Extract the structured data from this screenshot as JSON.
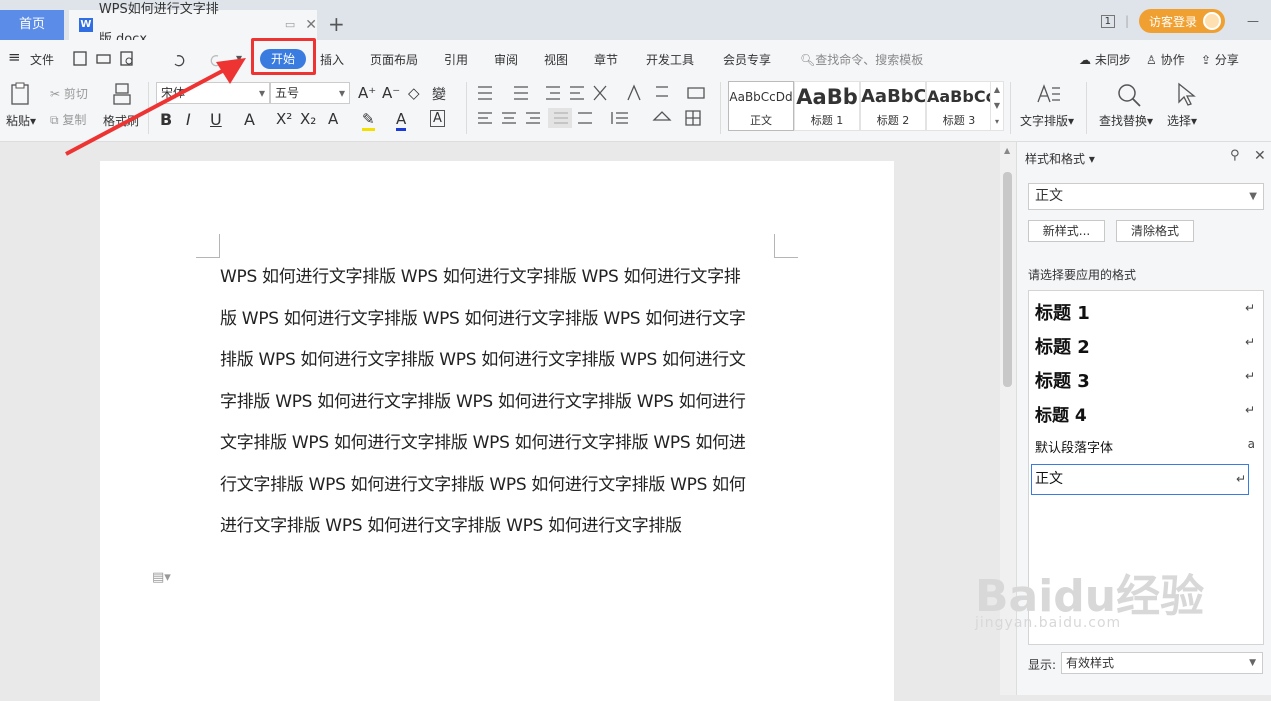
{
  "tabs": {
    "home": "首页",
    "doc": "WPS如何进行文字排版.docx",
    "new": "+"
  },
  "topright": {
    "window_num": "1",
    "login": "访客登录"
  },
  "menu": {
    "hamburger": "≡",
    "file": "文件",
    "items": [
      "开始",
      "插入",
      "页面布局",
      "引用",
      "审阅",
      "视图",
      "章节",
      "开发工具",
      "会员专享"
    ],
    "search": "查找命令、搜索模板",
    "sync": "未同步",
    "collab": "协作",
    "share": "分享"
  },
  "ribbon": {
    "paste": "粘贴",
    "cut": "剪切",
    "copy": "复制",
    "format_painter": "格式刷",
    "font": "宋体",
    "size": "五号",
    "styles": [
      {
        "preview": "AaBbCcDd",
        "label": "正文"
      },
      {
        "preview": "AaBb",
        "label": "标题 1"
      },
      {
        "preview": "AaBbC",
        "label": "标题 2"
      },
      {
        "preview": "AaBbCc",
        "label": "标题 3"
      }
    ],
    "text_layout": "文字排版",
    "find_replace": "查找替换",
    "select": "选择"
  },
  "document": {
    "lines": [
      "WPS 如何进行文字排版 WPS 如何进行文字排版 WPS 如何进行文字排",
      "版 WPS 如何进行文字排版 WPS 如何进行文字排版 WPS 如何进行文字",
      "排版 WPS 如何进行文字排版 WPS 如何进行文字排版 WPS 如何进行文",
      "字排版 WPS 如何进行文字排版 WPS 如何进行文字排版 WPS 如何进行",
      "文字排版 WPS 如何进行文字排版 WPS 如何进行文字排版 WPS 如何进",
      "行文字排版 WPS 如何进行文字排版 WPS 如何进行文字排版 WPS 如何",
      "进行文字排版 WPS 如何进行文字排版 WPS 如何进行文字排版"
    ]
  },
  "panel": {
    "title": "样式和格式",
    "current_style": "正文",
    "new_style": "新样式...",
    "clear_format": "清除格式",
    "apply_label": "请选择要应用的格式",
    "styles": [
      {
        "name": "标题  1",
        "mark": "↵"
      },
      {
        "name": "标题  2",
        "mark": "↵"
      },
      {
        "name": "标题  3",
        "mark": "↵"
      },
      {
        "name": "标题  4",
        "mark": "↵"
      },
      {
        "name": "默认段落字体",
        "mark": "a"
      },
      {
        "name": "正文",
        "mark": "↵"
      }
    ],
    "show_label": "显示:",
    "show_value": "有效样式"
  },
  "watermark": {
    "brand": "Baidu经验",
    "url": "jingyan.baidu.com"
  },
  "colors": {
    "accent": "#3a7be0",
    "highlight": "#e33333"
  }
}
